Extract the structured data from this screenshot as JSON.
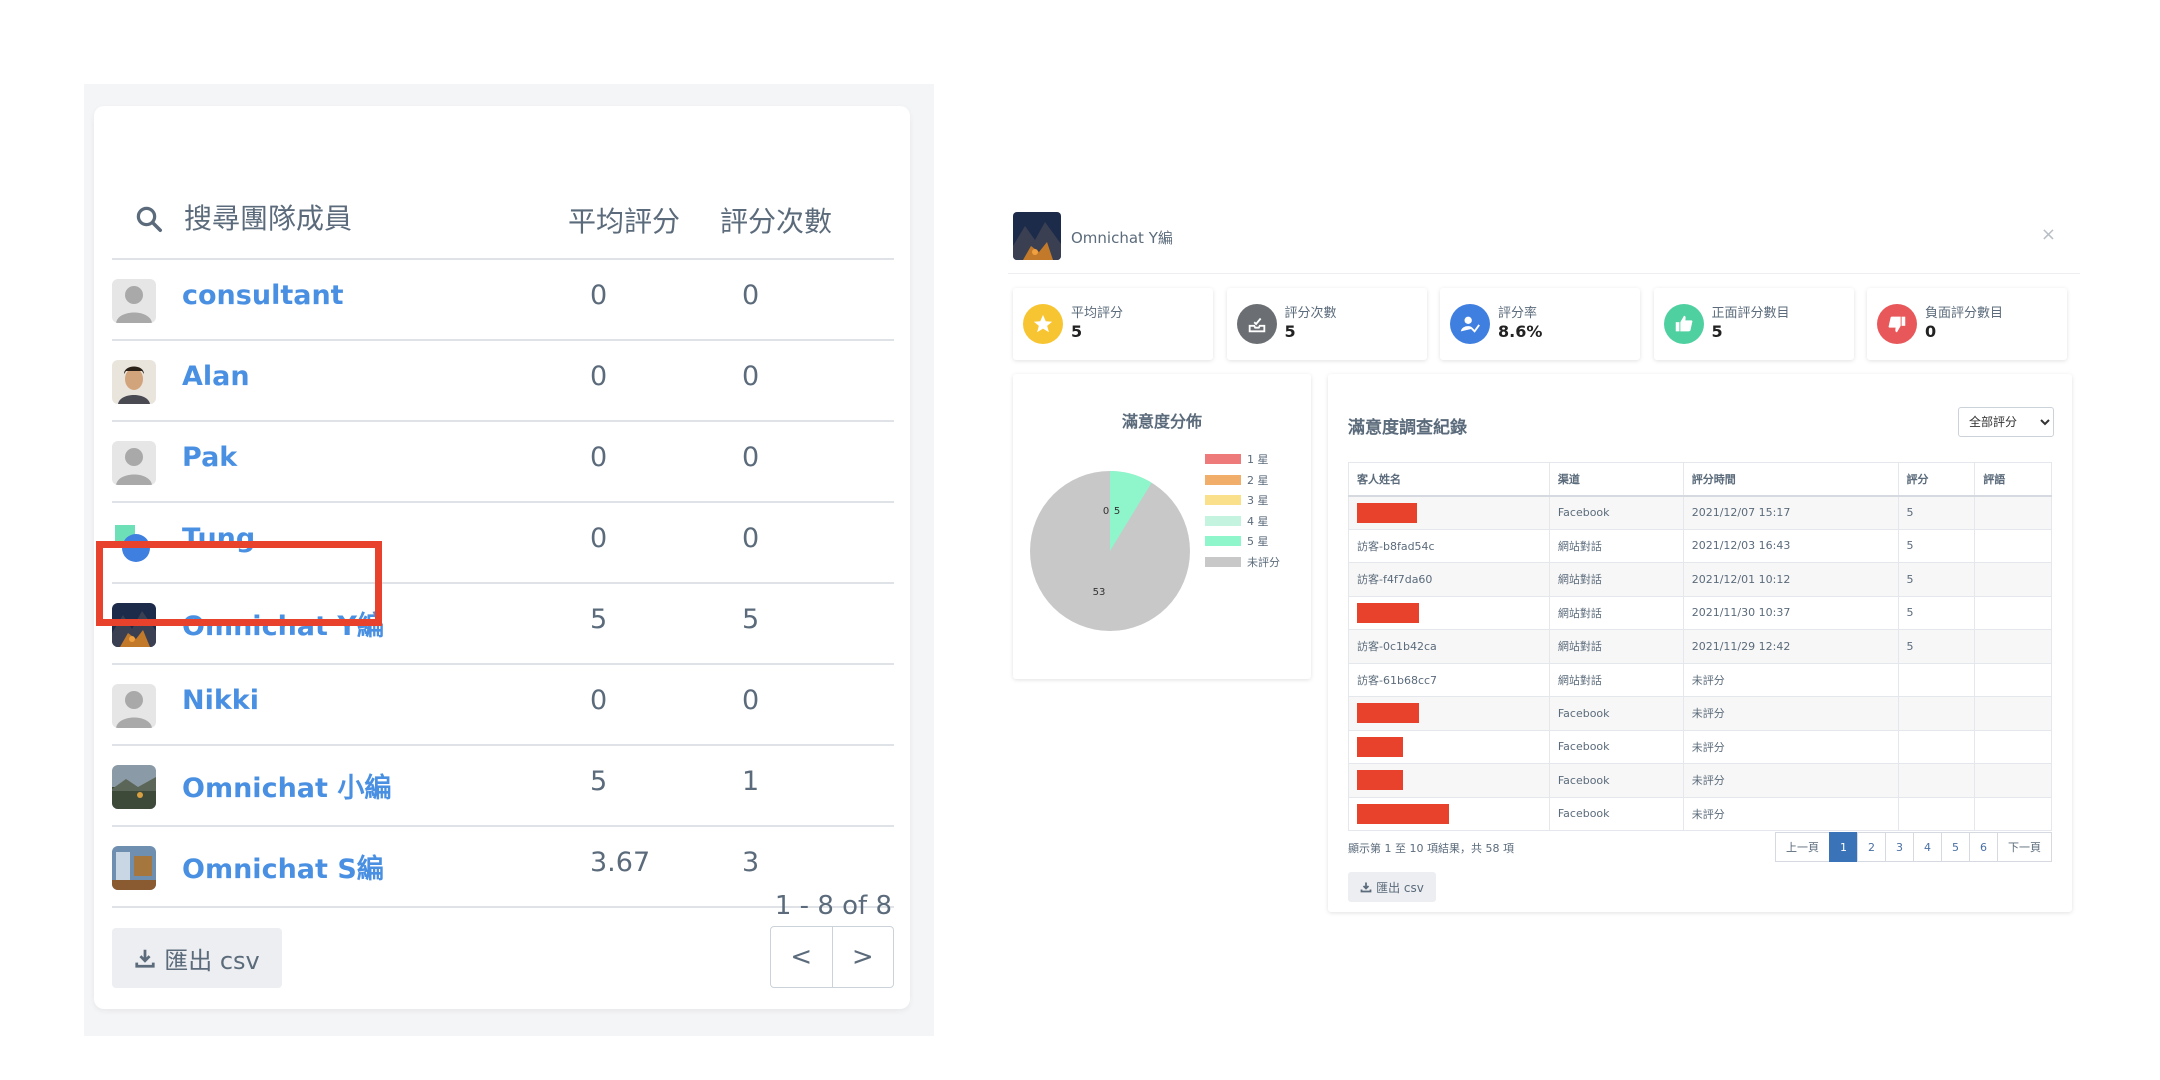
{
  "left": {
    "search_placeholder": "搜尋團隊成員",
    "col_avg": "平均評分",
    "col_count": "評分次數",
    "members": [
      {
        "name": "consultant",
        "avg": "0",
        "count": "0",
        "avatar": "placeholder"
      },
      {
        "name": "Alan",
        "avg": "0",
        "count": "0",
        "avatar": "photo-person"
      },
      {
        "name": "Pak",
        "avg": "0",
        "count": "0",
        "avatar": "placeholder"
      },
      {
        "name": "Tung",
        "avg": "0",
        "count": "0",
        "avatar": "logo-blue-green"
      },
      {
        "name": "Omnichat Y編",
        "avg": "5",
        "count": "5",
        "avatar": "photo-mountain"
      },
      {
        "name": "Nikki",
        "avg": "0",
        "count": "0",
        "avatar": "placeholder"
      },
      {
        "name": "Omnichat 小編",
        "avg": "5",
        "count": "1",
        "avatar": "photo-landscape"
      },
      {
        "name": "Omnichat S編",
        "avg": "3.67",
        "count": "3",
        "avatar": "photo-room"
      }
    ],
    "range": "1 - 8 of 8",
    "export_label": "匯出 csv",
    "prev": "<",
    "next": ">"
  },
  "right": {
    "title": "Omnichat Y編",
    "close": "×",
    "stats": [
      {
        "label": "平均評分",
        "value": "5",
        "icon": "star-icon",
        "color": "#f7c531"
      },
      {
        "label": "評分次數",
        "value": "5",
        "icon": "inbox-icon",
        "color": "#6b6f73"
      },
      {
        "label": "評分率",
        "value": "8.6%",
        "icon": "user-check-icon",
        "color": "#3f7fe0"
      },
      {
        "label": "正面評分數目",
        "value": "5",
        "icon": "thumbs-up-icon",
        "color": "#4fd0a0"
      },
      {
        "label": "負面評分數目",
        "value": "0",
        "icon": "thumbs-down-icon",
        "color": "#e8575a"
      }
    ],
    "pie": {
      "title": "滿意度分佈",
      "legend": [
        {
          "label": "1 星",
          "color": "#ee7a7a"
        },
        {
          "label": "2 星",
          "color": "#f0ae6a"
        },
        {
          "label": "3 星",
          "color": "#fbe08c"
        },
        {
          "label": "4 星",
          "color": "#c4f4e0"
        },
        {
          "label": "5 星",
          "color": "#8ff5cb"
        },
        {
          "label": "未評分",
          "color": "#c8c8c8"
        }
      ],
      "labels": {
        "zero": "0",
        "five": "5",
        "unrated": "53"
      }
    },
    "table": {
      "title": "滿意度調查紀錄",
      "filter": "全部評分",
      "headers": [
        "客人姓名",
        "渠道",
        "評分時間",
        "評分",
        "評語"
      ],
      "rows": [
        {
          "name": "",
          "redact": 60,
          "channel": "Facebook",
          "time": "2021/12/07 15:17",
          "score": "5",
          "comment": ""
        },
        {
          "name": "訪客-b8fad54c",
          "redact": 0,
          "channel": "網站對話",
          "time": "2021/12/03 16:43",
          "score": "5",
          "comment": ""
        },
        {
          "name": "訪客-f4f7da60",
          "redact": 0,
          "channel": "網站對話",
          "time": "2021/12/01 10:12",
          "score": "5",
          "comment": ""
        },
        {
          "name": "",
          "redact": 62,
          "channel": "網站對話",
          "time": "2021/11/30 10:37",
          "score": "5",
          "comment": ""
        },
        {
          "name": "訪客-0c1b42ca",
          "redact": 0,
          "channel": "網站對話",
          "time": "2021/11/29 12:42",
          "score": "5",
          "comment": ""
        },
        {
          "name": "訪客-61b68cc7",
          "redact": 0,
          "channel": "網站對話",
          "time": "未評分",
          "score": "",
          "comment": ""
        },
        {
          "name": "",
          "redact": 62,
          "channel": "Facebook",
          "time": "未評分",
          "score": "",
          "comment": ""
        },
        {
          "name": "",
          "redact": 46,
          "channel": "Facebook",
          "time": "未評分",
          "score": "",
          "comment": ""
        },
        {
          "name": "",
          "redact": 46,
          "channel": "Facebook",
          "time": "未評分",
          "score": "",
          "comment": ""
        },
        {
          "name": "",
          "redact": 92,
          "channel": "Facebook",
          "time": "未評分",
          "score": "",
          "comment": ""
        }
      ],
      "info": "顯示第 1 至 10 項結果，共 58 項",
      "pages": [
        "上一頁",
        "1",
        "2",
        "3",
        "4",
        "5",
        "6",
        "下一頁"
      ],
      "active_page": "1",
      "export_label": "匯出 csv"
    }
  }
}
